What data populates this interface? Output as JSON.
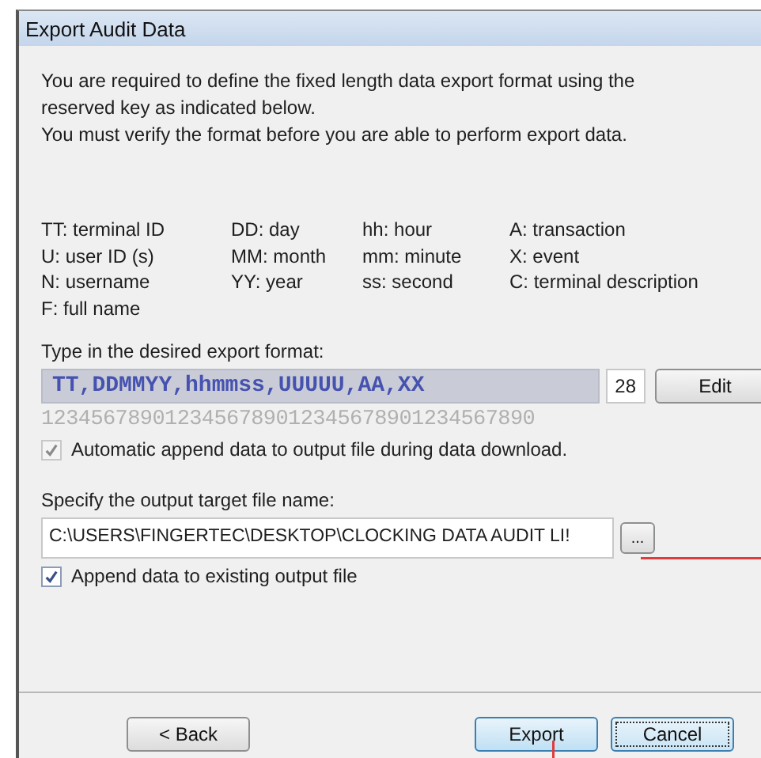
{
  "window": {
    "title": "Export Audit Data"
  },
  "intro": [
    "You are required to define the fixed length data export format using the reserved key as indicated below.",
    "You must verify the format before you are able to perform export data."
  ],
  "legend": [
    [
      "TT: terminal ID",
      "U: user ID (s)",
      "N: username",
      "F: full name"
    ],
    [
      "DD: day",
      "MM: month",
      "YY: year"
    ],
    [
      "hh: hour",
      "mm: minute",
      "ss: second"
    ],
    [
      "A: transaction",
      "X: event",
      "C: terminal description"
    ]
  ],
  "format": {
    "label": "Type in the desired export format:",
    "value": "TT,DDMMYY,hhmmss,UUUUU,AA,XX",
    "length": "28",
    "edit_button": "Edit",
    "ruler": "1234567890123456789012345678901234567890"
  },
  "auto_append": {
    "label": "Automatic append data to output file during data download.",
    "checked": true,
    "disabled": true
  },
  "output": {
    "label": "Specify the output target file name:",
    "value": "C:\\USERS\\FINGERTEC\\DESKTOP\\CLOCKING DATA AUDIT LI!",
    "browse_button": "..."
  },
  "append_existing": {
    "label": "Append data to existing output file",
    "checked": true,
    "disabled": false
  },
  "buttons": [
    {
      "label": "< Back",
      "focused": false
    },
    {
      "label": "Export",
      "focused": false
    },
    {
      "label": "Cancel",
      "focused": true
    }
  ]
}
